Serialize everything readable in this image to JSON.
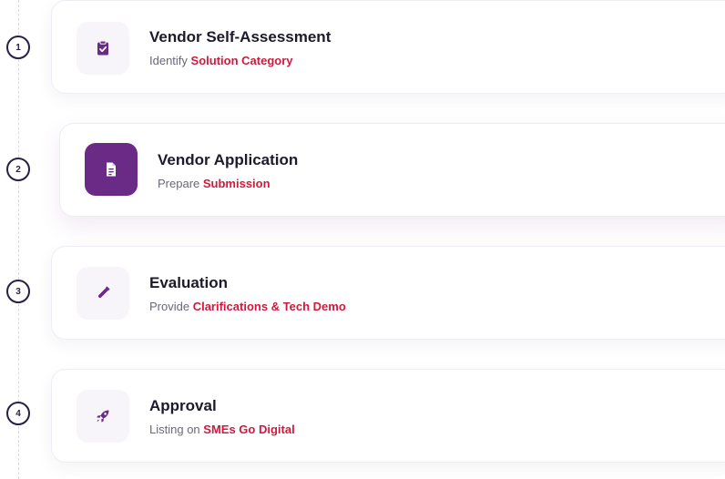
{
  "colors": {
    "accent_purple": "#6a2b87",
    "highlight_red": "#d0193d",
    "title_text": "#1e1a2b",
    "muted_text": "#6b6878"
  },
  "steps": [
    {
      "number": "1",
      "title": "Vendor Self-Assessment",
      "subtitle_prefix": "Identify",
      "subtitle_highlight": "Solution Category",
      "icon": "clipboard-check-icon",
      "active": false
    },
    {
      "number": "2",
      "title": "Vendor Application",
      "subtitle_prefix": "Prepare",
      "subtitle_highlight": "Submission",
      "icon": "document-icon",
      "active": true
    },
    {
      "number": "3",
      "title": "Evaluation",
      "subtitle_prefix": "Provide",
      "subtitle_highlight": "Clarifications & Tech Demo",
      "icon": "test-tube-icon",
      "active": false
    },
    {
      "number": "4",
      "title": "Approval",
      "subtitle_prefix": "Listing on",
      "subtitle_highlight": "SMEs Go Digital",
      "icon": "rocket-icon",
      "active": false
    }
  ]
}
